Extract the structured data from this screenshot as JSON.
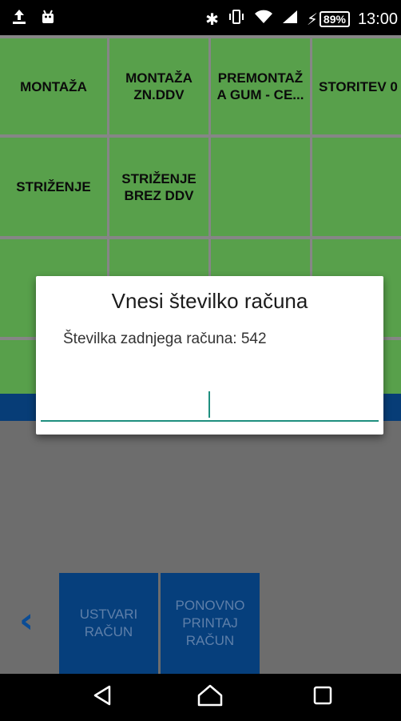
{
  "status_bar": {
    "left_icons": [
      "upload-notification-icon",
      "android-debug-icon"
    ],
    "right_icons": [
      "bluetooth-icon",
      "vibrate-icon",
      "wifi-icon",
      "cell-signal-icon",
      "charging-icon"
    ],
    "battery": "89%",
    "time": "13:00"
  },
  "tiles": [
    {
      "label": "MONTAŽA"
    },
    {
      "label": "MONTAŽA\nZN.DDV"
    },
    {
      "label": "PREMONTAŽ\nA GUM - CE..."
    },
    {
      "label": "STORITEV 0"
    },
    {
      "label": "STRIŽENJE"
    },
    {
      "label": "STRIŽENJE\nBREZ DDV"
    },
    {
      "label": ""
    },
    {
      "label": ""
    }
  ],
  "actions": {
    "create_invoice": "USTVARI\nRAČUN",
    "reprint_invoice": "PONOVNO\nPRINTAJ\nRAČUN"
  },
  "dialog": {
    "title": "Vnesi številko računa",
    "message": "Številka zadnjega računa: 542",
    "input_value": ""
  },
  "colors": {
    "tile_green": "#58a04b",
    "dark_blue": "#063f7c",
    "accent_teal": "#1f8f7f"
  }
}
